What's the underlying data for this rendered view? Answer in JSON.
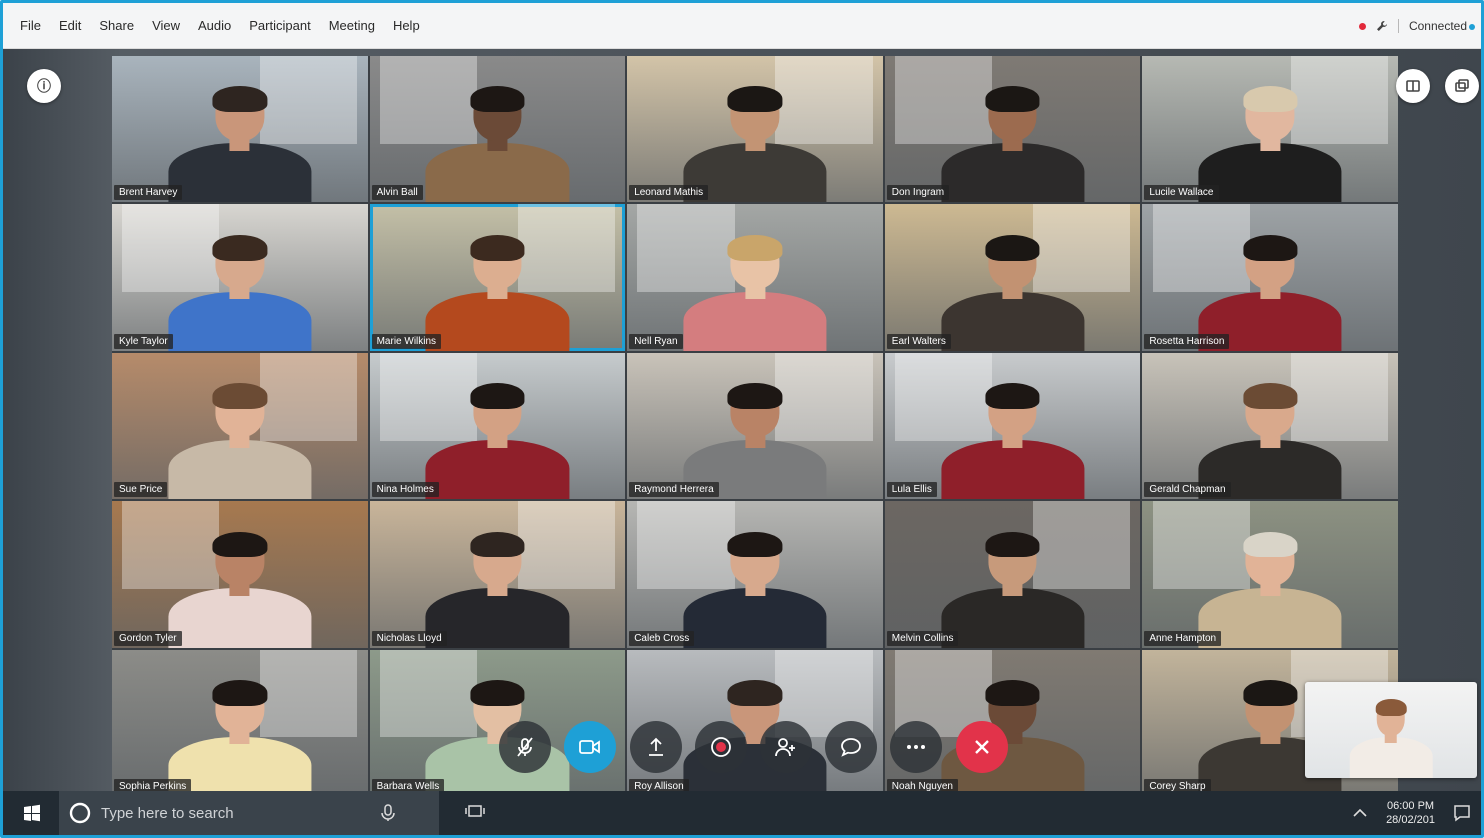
{
  "menu": [
    "File",
    "Edit",
    "Share",
    "View",
    "Audio",
    "Participant",
    "Meeting",
    "Help"
  ],
  "status": {
    "connection": "Connected"
  },
  "participants": [
    {
      "name": "Brent Harvey",
      "bg": "#a9b4bd",
      "shirt": "#2b3038",
      "skin": "#c9967a",
      "hair": "#2e2520"
    },
    {
      "name": "Alvin Ball",
      "bg": "#8a8a8a",
      "shirt": "#8a6a4a",
      "skin": "#6b4a37",
      "hair": "#1d1714"
    },
    {
      "name": "Leonard Mathis",
      "bg": "#d3c4a8",
      "shirt": "#3d3a36",
      "skin": "#c39474",
      "hair": "#1b1714"
    },
    {
      "name": "Don Ingram",
      "bg": "#7f7a74",
      "shirt": "#2c2a2a",
      "skin": "#9c6b4f",
      "hair": "#1b1714"
    },
    {
      "name": "Lucile Wallace",
      "bg": "#b6b9b3",
      "shirt": "#1e1e1e",
      "skin": "#e1b79f",
      "hair": "#d8c9ad"
    },
    {
      "name": "Kyle Taylor",
      "bg": "#d8d6d1",
      "shirt": "#3f74c9",
      "skin": "#d7a98d",
      "hair": "#3a2a20"
    },
    {
      "name": "Marie Wilkins",
      "bg": "#c4c0a7",
      "shirt": "#b4491e",
      "skin": "#dcae90",
      "hair": "#3c2a1f"
    },
    {
      "name": "Nell Ryan",
      "bg": "#a4a7a5",
      "shirt": "#d47d7f",
      "skin": "#e8c3a6",
      "hair": "#c9a56a"
    },
    {
      "name": "Earl Walters",
      "bg": "#cdb992",
      "shirt": "#3c3530",
      "skin": "#c29272",
      "hair": "#1b1714"
    },
    {
      "name": "Rosetta Harrison",
      "bg": "#9ea3a6",
      "shirt": "#8f1f2a",
      "skin": "#d3a184",
      "hair": "#1d1714"
    },
    {
      "name": "Sue Price",
      "bg": "#b68b6a",
      "shirt": "#c7b9a7",
      "skin": "#e1b397",
      "hair": "#6b4b34"
    },
    {
      "name": "Nina Holmes",
      "bg": "#c6cbcd",
      "shirt": "#8f1f2a",
      "skin": "#d3a184",
      "hair": "#1d1714"
    },
    {
      "name": "Raymond Herrera",
      "bg": "#c9c3b9",
      "shirt": "#7a7b7c",
      "skin": "#b98366",
      "hair": "#1d1714"
    },
    {
      "name": "Lula Ellis",
      "bg": "#c8cbcd",
      "shirt": "#8f1f2a",
      "skin": "#d3a184",
      "hair": "#1d1714"
    },
    {
      "name": "Gerald Chapman",
      "bg": "#c8c3b9",
      "shirt": "#2c2a28",
      "skin": "#d9a98c",
      "hair": "#6b4b34"
    },
    {
      "name": "Gordon Tyler",
      "bg": "#a7794f",
      "shirt": "#e8d5d0",
      "skin": "#b98366",
      "hair": "#1d1714"
    },
    {
      "name": "Nicholas Lloyd",
      "bg": "#c9b59a",
      "shirt": "#26262a",
      "skin": "#d7a98d",
      "hair": "#2e2520"
    },
    {
      "name": "Caleb Cross",
      "bg": "#b6b6b3",
      "shirt": "#242a36",
      "skin": "#d7a98d",
      "hair": "#1d1714"
    },
    {
      "name": "Melvin Collins",
      "bg": "#6c6762",
      "shirt": "#2a2826",
      "skin": "#c79a7b",
      "hair": "#1d1714"
    },
    {
      "name": "Anne Hampton",
      "bg": "#8d9282",
      "shirt": "#c7b493",
      "skin": "#e1b397",
      "hair": "#d9d4c8"
    },
    {
      "name": "Sophia Perkins",
      "bg": "#8c8c88",
      "shirt": "#efe1ad",
      "skin": "#e1b397",
      "hair": "#1d1714"
    },
    {
      "name": "Barbara Wells",
      "bg": "#8d9a8a",
      "shirt": "#a9c3a7",
      "skin": "#e3bfa3",
      "hair": "#1d1714"
    },
    {
      "name": "Roy Allison",
      "bg": "#b8bbbe",
      "shirt": "#2b3038",
      "skin": "#c9967a",
      "hair": "#2e2520"
    },
    {
      "name": "Noah Nguyen",
      "bg": "#807a72",
      "shirt": "#6e5841",
      "skin": "#6b4a37",
      "hair": "#1d1714"
    },
    {
      "name": "Corey Sharp",
      "bg": "#c2b49b",
      "shirt": "#3c3833",
      "skin": "#c29272",
      "hair": "#1b1714"
    }
  ],
  "active_speaker": "Marie Wilkins",
  "controls": {
    "mute": "microphone-off-icon",
    "video": "video-camera-icon",
    "share": "share-upload-icon",
    "record": "record-icon",
    "participants": "participants-icon",
    "chat": "chat-icon",
    "more": "more-icon",
    "end": "end-call-icon"
  },
  "accent_color": "#1ea0d6",
  "end_call_color": "#e2334a",
  "taskbar": {
    "search_placeholder": "Type here to search",
    "time": "06:00 PM",
    "date": "28/02/201"
  }
}
